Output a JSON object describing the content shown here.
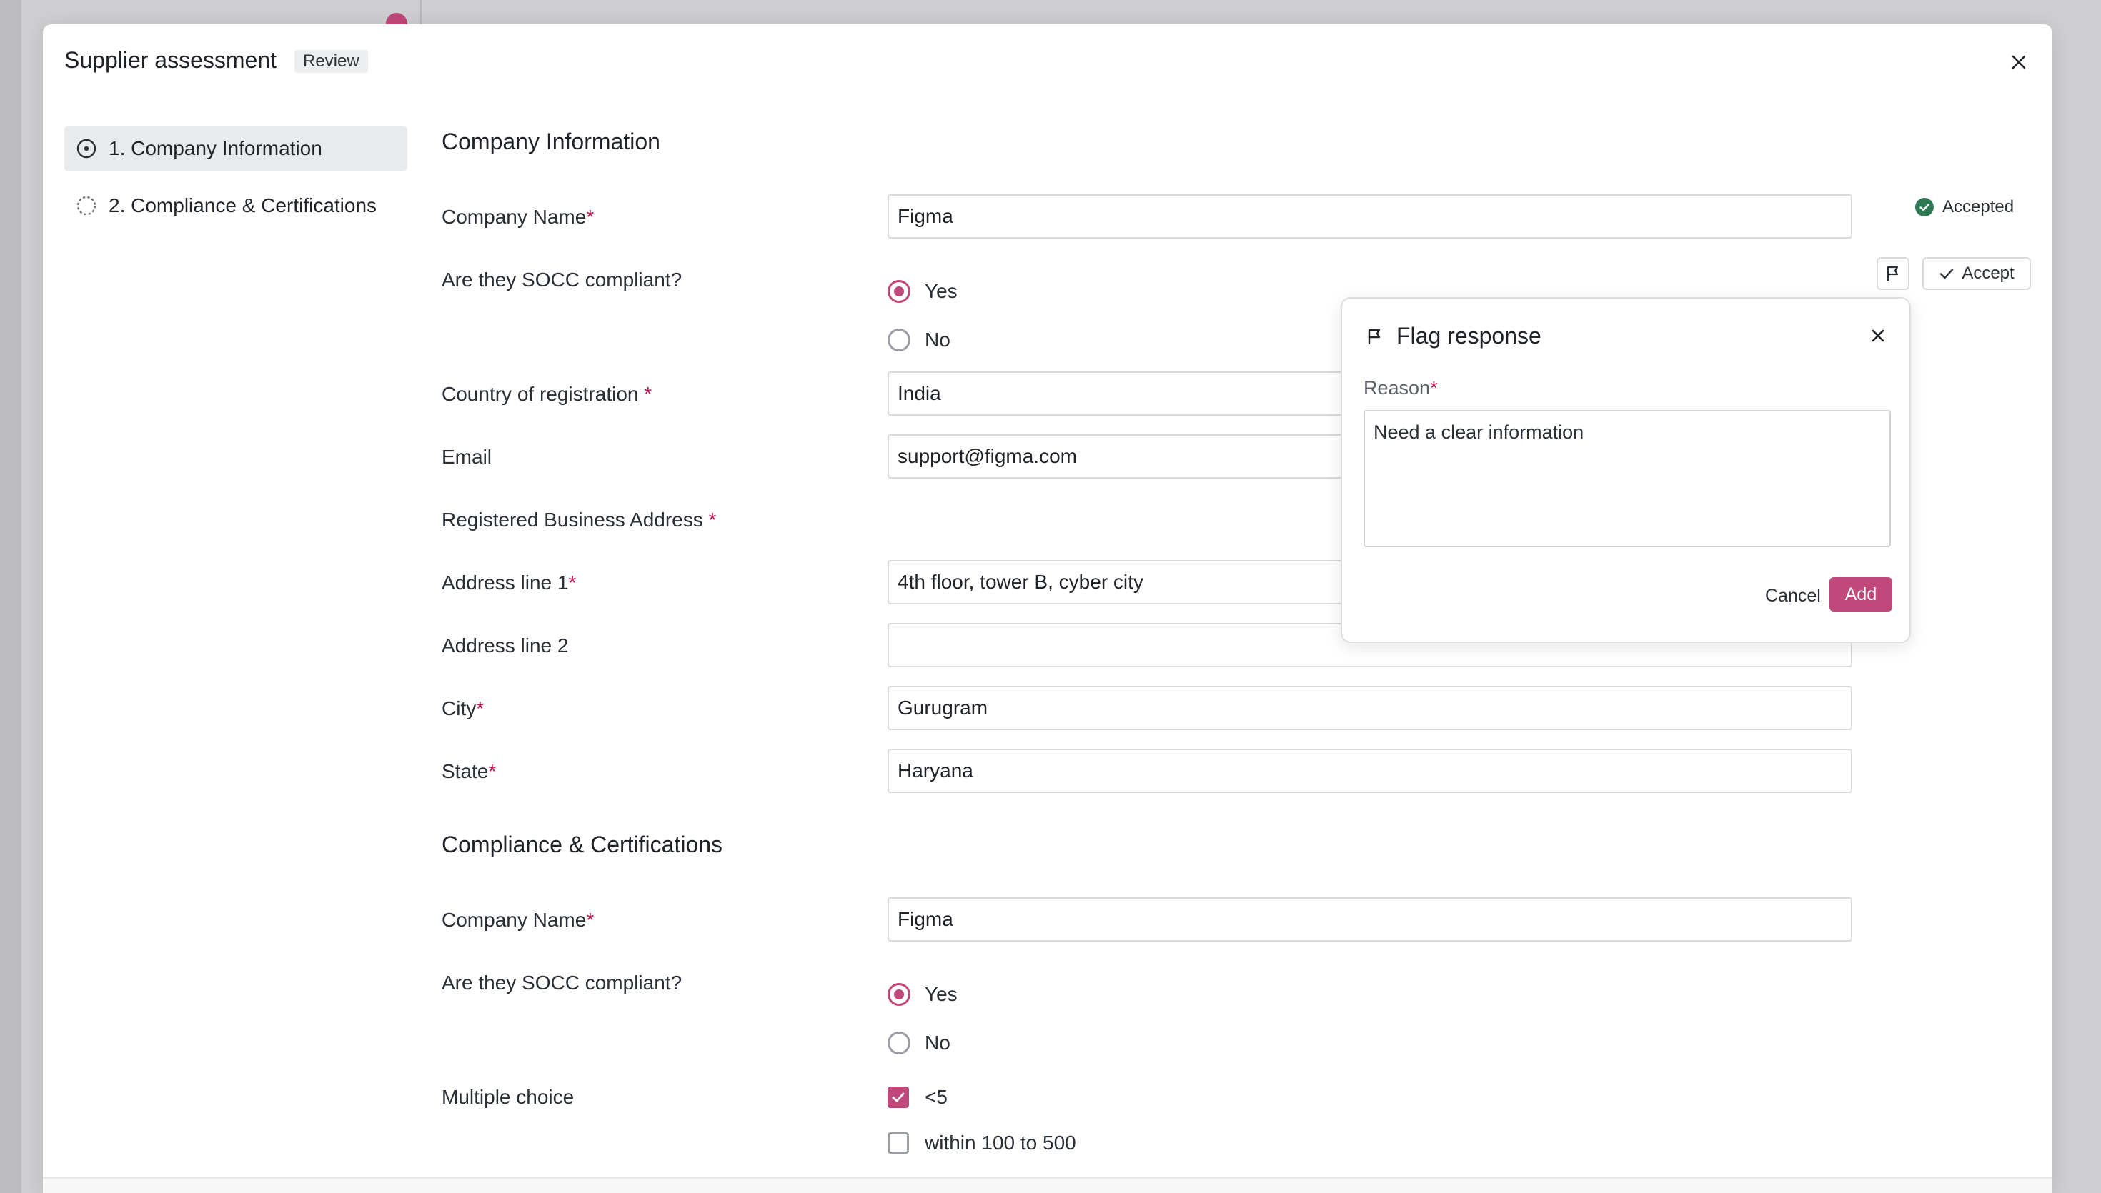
{
  "modal": {
    "title": "Supplier assessment",
    "status_badge": "Review",
    "accent_color": "#c0487a"
  },
  "nav": {
    "items": [
      {
        "label": "1. Company Information",
        "active": true
      },
      {
        "label": "2. Compliance & Certifications",
        "active": false
      }
    ]
  },
  "sections": {
    "company_information": {
      "title": "Company Information",
      "fields": {
        "company_name": {
          "label": "Company Name",
          "value": "Figma"
        },
        "socc": {
          "label": "Are they SOCC compliant?",
          "options": [
            "Yes",
            "No"
          ],
          "selected": "Yes"
        },
        "country": {
          "label": "Country of registration",
          "value": "India"
        },
        "email": {
          "label": "Email",
          "value": "support@figma.com"
        },
        "address_heading": {
          "label": "Registered Business Address"
        },
        "address1": {
          "label": "Address line 1",
          "value": "4th floor, tower B, cyber city"
        },
        "address2": {
          "label": "Address line 2",
          "value": ""
        },
        "city": {
          "label": "City",
          "value": "Gurugram"
        },
        "state": {
          "label": "State",
          "value": "Haryana"
        }
      },
      "status": {
        "accepted_label": "Accepted",
        "accept_button": "Accept"
      }
    },
    "compliance": {
      "title": "Compliance & Certifications",
      "fields": {
        "company_name": {
          "label": "Company Name",
          "value": "Figma"
        },
        "socc": {
          "label": "Are they SOCC compliant?",
          "options": [
            "Yes",
            "No"
          ],
          "selected": "Yes"
        },
        "multiple_choice": {
          "label": "Multiple choice",
          "options": [
            "<5",
            "within 100 to 500"
          ],
          "checked": [
            "<5"
          ]
        }
      }
    }
  },
  "flag_popover": {
    "title": "Flag response",
    "reason_label": "Reason",
    "reason_value": "Need a clear information",
    "cancel_label": "Cancel",
    "add_label": "Add"
  },
  "required_marker": "*"
}
